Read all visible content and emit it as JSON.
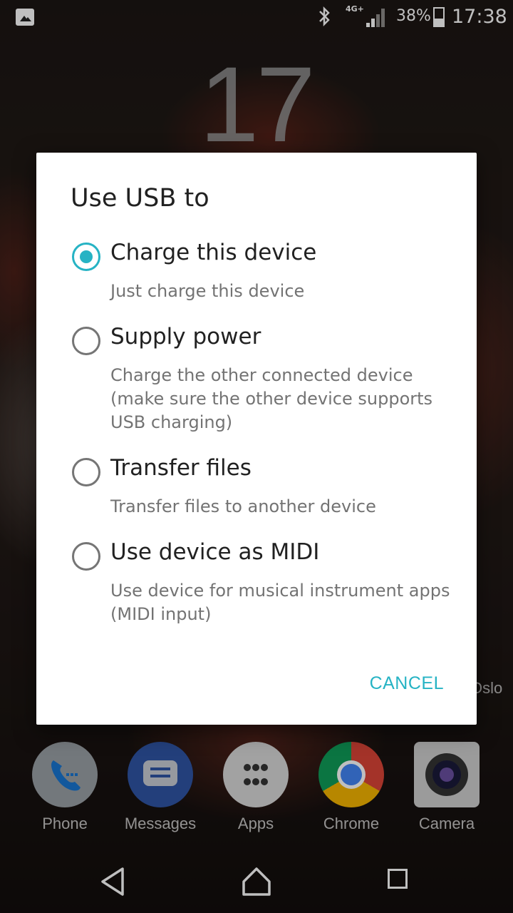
{
  "status_bar": {
    "network": "4G+",
    "battery_pct": "38%",
    "time": "17:38",
    "icons": [
      "image-notification-icon",
      "bluetooth-icon",
      "signal-icon",
      "battery-icon"
    ]
  },
  "lockscreen": {
    "clock_digit": "17"
  },
  "dock": {
    "items": [
      {
        "label": "Phone",
        "icon": "phone-icon"
      },
      {
        "label": "Messages",
        "icon": "messages-icon"
      },
      {
        "label": "Apps",
        "icon": "apps-grid-icon"
      },
      {
        "label": "Chrome",
        "icon": "chrome-icon"
      },
      {
        "label": "Camera",
        "icon": "camera-icon"
      }
    ],
    "widget_label": "Oslo"
  },
  "dialog": {
    "title": "Use USB to",
    "options": [
      {
        "title": "Charge this device",
        "description": "Just charge this device",
        "selected": true
      },
      {
        "title": "Supply power",
        "description": "Charge the other connected device (make sure the other device supports USB charging)",
        "selected": false
      },
      {
        "title": "Transfer files",
        "description": "Transfer files to another device",
        "selected": false
      },
      {
        "title": "Use device as MIDI",
        "description": "Use device for musical instrument apps (MIDI input)",
        "selected": false
      }
    ],
    "cancel_label": "CANCEL"
  },
  "colors": {
    "accent": "#26b3c4",
    "title_text": "#212121",
    "secondary_text": "#737373"
  }
}
